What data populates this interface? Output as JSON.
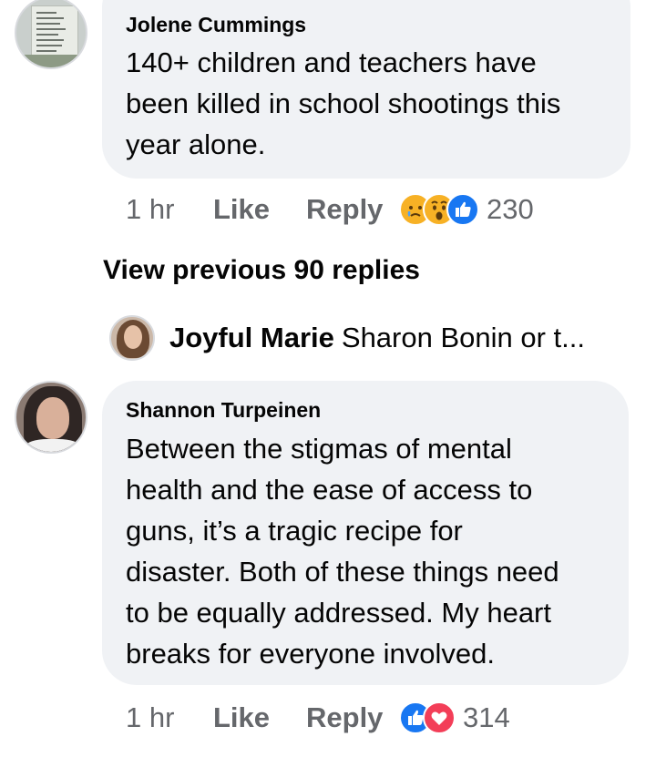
{
  "comments": [
    {
      "author": "Jolene Cummings",
      "text_lines": [
        "140+ children and teachers have",
        "been killed in school shootings this",
        "year alone."
      ],
      "time": "1 hr",
      "like_label": "Like",
      "reply_label": "Reply",
      "reactions": [
        "sad",
        "wow",
        "like"
      ],
      "reaction_count": "230"
    },
    {
      "author": "Shannon Turpeinen",
      "text_lines": [
        "Between the stigmas of mental",
        "health and the ease of access to",
        "guns, it’s a tragic recipe for",
        "disaster. Both of these things need",
        "to be equally addressed. My heart",
        "breaks for everyone involved."
      ],
      "time": "1 hr",
      "like_label": "Like",
      "reply_label": "Reply",
      "reactions": [
        "like",
        "love"
      ],
      "reaction_count": "314"
    }
  ],
  "view_previous_replies": "View previous 90 replies",
  "reply_preview": {
    "author": "Joyful Marie",
    "snippet": "Sharon Bonin or t..."
  },
  "colors": {
    "bubble": "#f0f2f5",
    "secondary_text": "#65676b",
    "like_blue": "#1877f2",
    "love_red": "#f33e58",
    "emoji_yellow": "#f7b125"
  }
}
